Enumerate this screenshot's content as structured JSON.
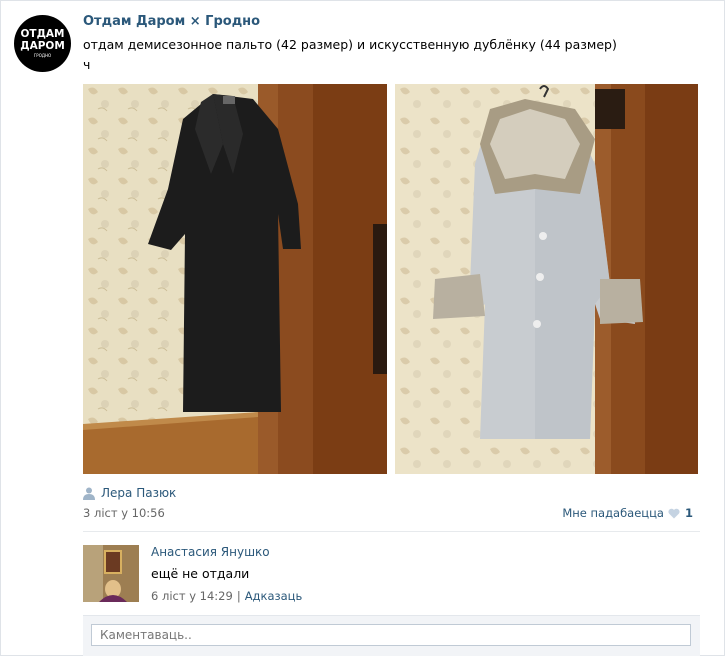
{
  "post": {
    "group_name": "Отдам Даром × Гродно",
    "avatar_text_line1": "ОТДАМ",
    "avatar_text_line2": "ДАРОМ",
    "avatar_text_small": "ГРОДНО",
    "text_line1": "отдам демисезонное пальто (42 размер) и искусственную дублёнку (44 размер)",
    "text_line2": "ч",
    "author": "Лера Пазюк",
    "date": "3 ліст у 10:56",
    "like_label": "Мне падабаецца",
    "like_count": "1"
  },
  "comment": {
    "author": "Анастасия Янушко",
    "text": "ещё не отдали",
    "date": "6 ліст у 14:29",
    "separator": "|",
    "reply_label": "Адказаць"
  },
  "comment_box": {
    "placeholder": "Каментаваць.."
  },
  "colors": {
    "link": "#2b587a",
    "secondary": "#666666",
    "divider": "#e7eaed"
  },
  "icons": {
    "author": "user-icon",
    "like": "heart-icon"
  }
}
